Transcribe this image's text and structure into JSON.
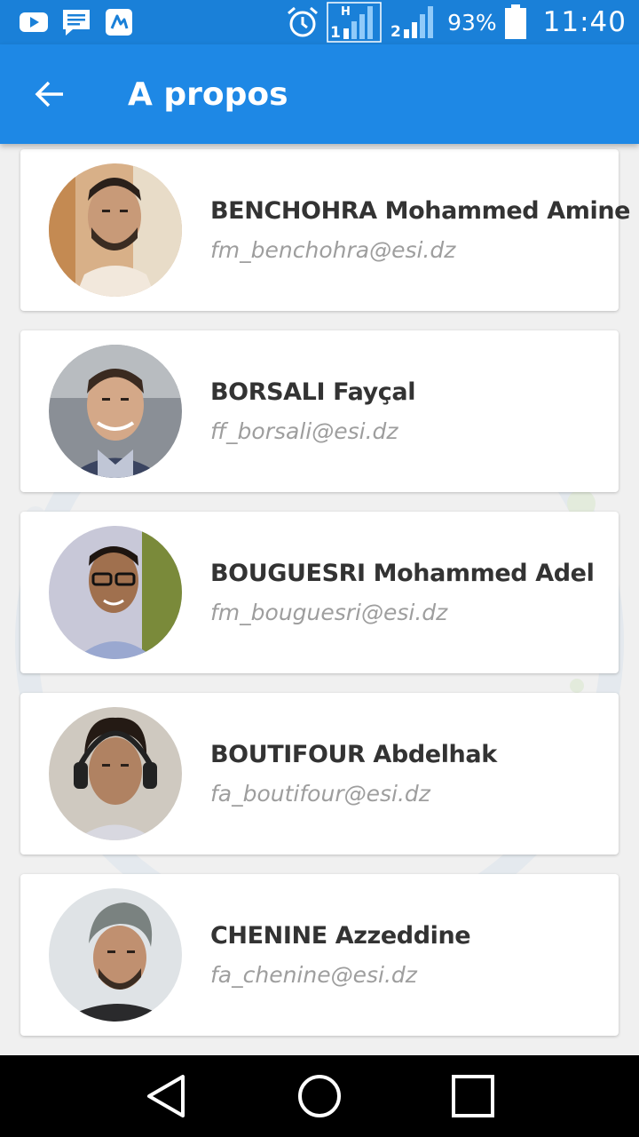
{
  "status_bar": {
    "battery_percent": "93%",
    "time": "11:40",
    "icons": [
      "youtube-icon",
      "message-icon",
      "app-icon",
      "alarm-icon",
      "signal-sim1-icon",
      "signal-sim2-icon",
      "battery-icon"
    ],
    "sim1_network": "H",
    "sim1_label": "1",
    "sim2_label": "2"
  },
  "app_bar": {
    "title": "A propos",
    "back_icon": "arrow-left-icon"
  },
  "members": [
    {
      "name": "BENCHOHRA Mohammed Amine",
      "email": "fm_benchohra@esi.dz"
    },
    {
      "name": "BORSALI Fayçal",
      "email": "ff_borsali@esi.dz"
    },
    {
      "name": "BOUGUESRI Mohammed Adel",
      "email": "fm_bouguesri@esi.dz"
    },
    {
      "name": "BOUTIFOUR Abdelhak",
      "email": "fa_boutifour@esi.dz"
    },
    {
      "name": "CHENINE Azzeddine",
      "email": "fa_chenine@esi.dz"
    }
  ],
  "nav_bar": {
    "icons": [
      "back-triangle-icon",
      "home-circle-icon",
      "recents-square-icon"
    ]
  },
  "colors": {
    "primary": "#1e88e5",
    "status_bar": "#1a80d8",
    "background": "#f0f0f0",
    "name_text": "#333333",
    "email_text": "#9e9e9e"
  }
}
